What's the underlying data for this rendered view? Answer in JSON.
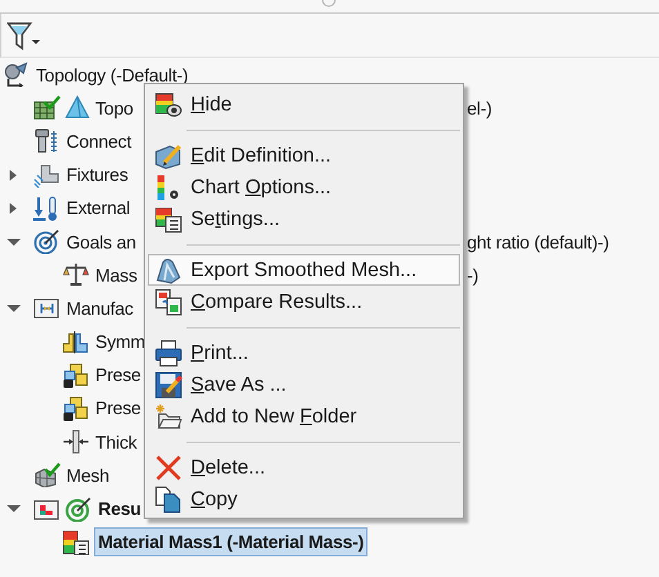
{
  "tree": [
    {
      "label": "Topology (-Default-)",
      "kind": "study",
      "children": [
        {
          "label": "Topo",
          "tail": "el-)",
          "kind": "topology"
        },
        {
          "label": "Connect",
          "kind": "connections"
        },
        {
          "label": "Fixtures",
          "kind": "fixtures",
          "expanded": false
        },
        {
          "label": "External",
          "kind": "loads",
          "expanded": false
        },
        {
          "label": "Goals an",
          "tail": "ght ratio (default)-)",
          "kind": "goals",
          "expanded": true,
          "children": [
            {
              "label": "Mass",
              "tail": "-)",
              "kind": "balance"
            }
          ]
        },
        {
          "label": "Manufac",
          "kind": "folder",
          "expanded": true,
          "children": [
            {
              "label": "Symm",
              "kind": "symmetry"
            },
            {
              "label": "Prese",
              "kind": "lock"
            },
            {
              "label": "Prese",
              "kind": "lock"
            },
            {
              "label": "Thick",
              "kind": "thickness"
            }
          ]
        },
        {
          "label": "Mesh",
          "kind": "mesh"
        },
        {
          "label": "Resu",
          "kind": "results",
          "active": true,
          "expanded": true,
          "children": [
            {
              "label": "Material Mass1 (-Material Mass-)",
              "kind": "plot",
              "active": true,
              "selected": true
            }
          ]
        }
      ]
    }
  ],
  "menu": [
    {
      "kind": "hide",
      "key": "H",
      "post": "ide",
      "highlighted": false
    },
    {
      "kind": "separator"
    },
    {
      "kind": "edit",
      "key": "E",
      "post": "dit Definition...",
      "highlighted": false
    },
    {
      "kind": "chart",
      "pre": "Chart ",
      "key": "O",
      "post": "ptions...",
      "highlighted": false
    },
    {
      "kind": "settings",
      "pre": "Se",
      "key": "t",
      "post": "tings...",
      "highlighted": false
    },
    {
      "kind": "separator"
    },
    {
      "kind": "export",
      "pre": "Export Smoothed Mesh...",
      "highlighted": true
    },
    {
      "kind": "compare",
      "key": "C",
      "post": "ompare Results...",
      "highlighted": false
    },
    {
      "kind": "separator"
    },
    {
      "kind": "print",
      "key": "P",
      "post": "rint...",
      "highlighted": false
    },
    {
      "kind": "save",
      "key": "S",
      "post": "ave As ...",
      "highlighted": false
    },
    {
      "kind": "folder",
      "pre": "Add to New ",
      "key": "F",
      "post": "older",
      "highlighted": false
    },
    {
      "kind": "separator"
    },
    {
      "kind": "delete",
      "key": "D",
      "post": "elete...",
      "highlighted": false
    },
    {
      "kind": "copy",
      "key": "C",
      "post": "opy",
      "highlighted": false
    }
  ]
}
